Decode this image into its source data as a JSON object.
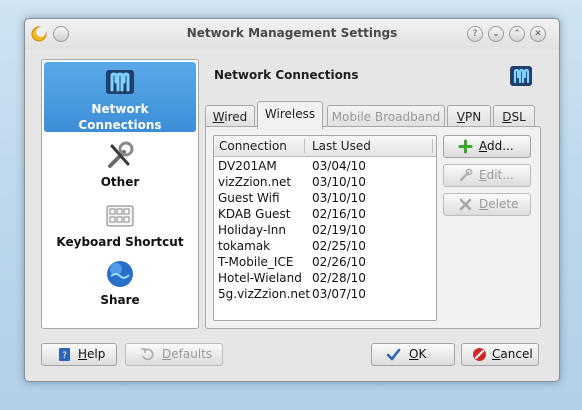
{
  "window": {
    "title": "Network Management Settings"
  },
  "sidebar": {
    "items": [
      {
        "label_line1": "Network",
        "label_line2": "Connections",
        "icon": "network-manager-icon",
        "selected": true
      },
      {
        "label": "Other",
        "icon": "tools-icon"
      },
      {
        "label": "Keyboard Shortcut",
        "icon": "keyboard-icon"
      },
      {
        "label": "Share",
        "icon": "globe-icon"
      }
    ]
  },
  "header": {
    "title": "Network Connections",
    "logo": "network-manager-icon"
  },
  "tabs": [
    {
      "label": "Wired",
      "mnemonic": "W",
      "rest": "ired"
    },
    {
      "label": "Wireless",
      "active": true
    },
    {
      "label": "Mobile Broadband",
      "disabled": true
    },
    {
      "label": "VPN",
      "mnemonic": "V",
      "rest": "PN"
    },
    {
      "label": "DSL",
      "mnemonic": "D",
      "rest": "SL"
    }
  ],
  "connections_table": {
    "headers": [
      "Connection",
      "Last Used"
    ],
    "rows": [
      [
        "DV201AM",
        "03/04/10"
      ],
      [
        "vizZzion.net",
        "03/10/10"
      ],
      [
        "Guest Wifi",
        "03/10/10"
      ],
      [
        "KDAB Guest",
        "02/16/10"
      ],
      [
        "Holiday-Inn",
        "02/19/10"
      ],
      [
        "tokamak",
        "02/25/10"
      ],
      [
        "T-Mobile_ICE",
        "02/26/10"
      ],
      [
        "Hotel-Wieland",
        "02/28/10"
      ],
      [
        "5g.vizZzion.net",
        "03/07/10"
      ]
    ]
  },
  "actions": {
    "add": {
      "label": "Add...",
      "mnemonic": "A",
      "rest": "dd..."
    },
    "edit": {
      "label": "Edit...",
      "mnemonic": "E",
      "rest": "dit...",
      "disabled": true
    },
    "delete": {
      "label": "Delete",
      "mnemonic": "D",
      "rest": "elete",
      "disabled": true
    }
  },
  "footer": {
    "help": {
      "label": "Help",
      "mnemonic": "H",
      "rest": "elp"
    },
    "defaults": {
      "label": "Defaults",
      "mnemonic": "D",
      "rest": "efaults",
      "disabled": true
    },
    "ok": {
      "label": "OK",
      "mnemonic": "O",
      "rest": "K"
    },
    "cancel": {
      "label": "Cancel",
      "mnemonic": "C",
      "rest": "ancel"
    }
  },
  "colors": {
    "selection": "#3c8dd6",
    "add_icon": "#3aa52b",
    "cancel_icon": "#d22a2a",
    "ok_icon": "#2f63b5"
  }
}
